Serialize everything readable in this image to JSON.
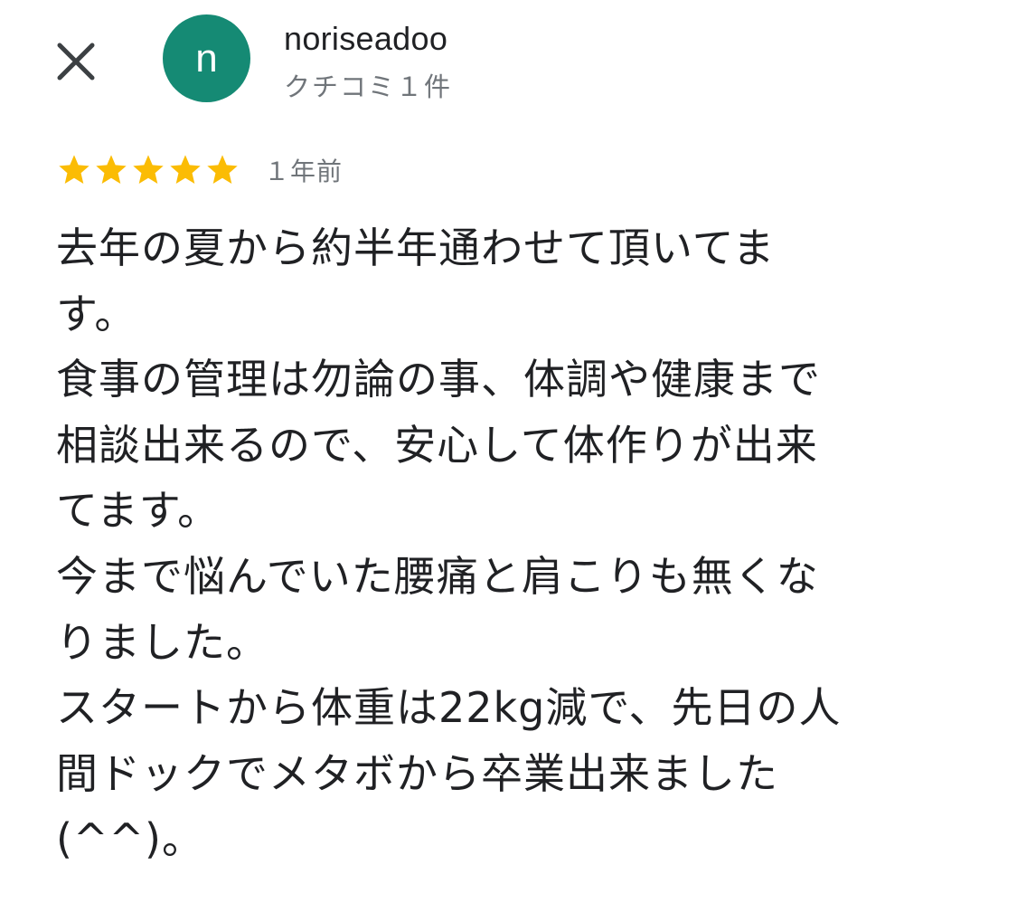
{
  "header": {
    "close_icon": "close-icon",
    "avatar_letter": "n",
    "avatar_color": "#158a74",
    "user_name": "noriseadoo",
    "review_count": "クチコミ１件"
  },
  "review": {
    "rating": 5,
    "rating_max": 5,
    "star_color": "#fbbc04",
    "date": "１年前",
    "lines": [
      "去年の夏から約半年通わせて頂いてま",
      "す。",
      "食事の管理は勿論の事、体調や健康まで",
      "相談出来るので、安心して体作りが出来",
      "てます。",
      "今まで悩んでいた腰痛と肩こりも無くな",
      "りました。",
      "スタートから体重は22kg減で、先日の人",
      "間ドックでメタボから卒業出来ました",
      "(^^)。"
    ]
  }
}
